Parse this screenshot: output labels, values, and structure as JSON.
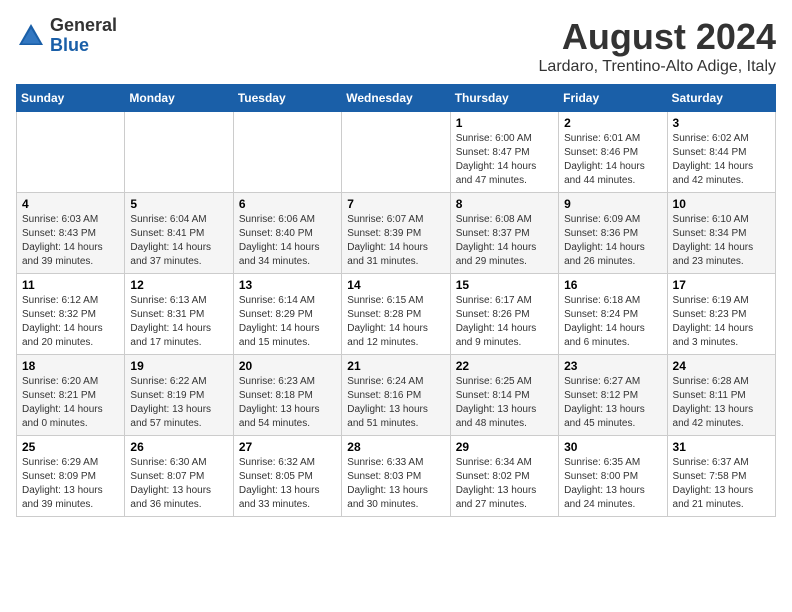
{
  "header": {
    "logo_general": "General",
    "logo_blue": "Blue",
    "month": "August 2024",
    "location": "Lardaro, Trentino-Alto Adige, Italy"
  },
  "weekdays": [
    "Sunday",
    "Monday",
    "Tuesday",
    "Wednesday",
    "Thursday",
    "Friday",
    "Saturday"
  ],
  "weeks": [
    [
      {
        "day": "",
        "content": ""
      },
      {
        "day": "",
        "content": ""
      },
      {
        "day": "",
        "content": ""
      },
      {
        "day": "",
        "content": ""
      },
      {
        "day": "1",
        "content": "Sunrise: 6:00 AM\nSunset: 8:47 PM\nDaylight: 14 hours\nand 47 minutes."
      },
      {
        "day": "2",
        "content": "Sunrise: 6:01 AM\nSunset: 8:46 PM\nDaylight: 14 hours\nand 44 minutes."
      },
      {
        "day": "3",
        "content": "Sunrise: 6:02 AM\nSunset: 8:44 PM\nDaylight: 14 hours\nand 42 minutes."
      }
    ],
    [
      {
        "day": "4",
        "content": "Sunrise: 6:03 AM\nSunset: 8:43 PM\nDaylight: 14 hours\nand 39 minutes."
      },
      {
        "day": "5",
        "content": "Sunrise: 6:04 AM\nSunset: 8:41 PM\nDaylight: 14 hours\nand 37 minutes."
      },
      {
        "day": "6",
        "content": "Sunrise: 6:06 AM\nSunset: 8:40 PM\nDaylight: 14 hours\nand 34 minutes."
      },
      {
        "day": "7",
        "content": "Sunrise: 6:07 AM\nSunset: 8:39 PM\nDaylight: 14 hours\nand 31 minutes."
      },
      {
        "day": "8",
        "content": "Sunrise: 6:08 AM\nSunset: 8:37 PM\nDaylight: 14 hours\nand 29 minutes."
      },
      {
        "day": "9",
        "content": "Sunrise: 6:09 AM\nSunset: 8:36 PM\nDaylight: 14 hours\nand 26 minutes."
      },
      {
        "day": "10",
        "content": "Sunrise: 6:10 AM\nSunset: 8:34 PM\nDaylight: 14 hours\nand 23 minutes."
      }
    ],
    [
      {
        "day": "11",
        "content": "Sunrise: 6:12 AM\nSunset: 8:32 PM\nDaylight: 14 hours\nand 20 minutes."
      },
      {
        "day": "12",
        "content": "Sunrise: 6:13 AM\nSunset: 8:31 PM\nDaylight: 14 hours\nand 17 minutes."
      },
      {
        "day": "13",
        "content": "Sunrise: 6:14 AM\nSunset: 8:29 PM\nDaylight: 14 hours\nand 15 minutes."
      },
      {
        "day": "14",
        "content": "Sunrise: 6:15 AM\nSunset: 8:28 PM\nDaylight: 14 hours\nand 12 minutes."
      },
      {
        "day": "15",
        "content": "Sunrise: 6:17 AM\nSunset: 8:26 PM\nDaylight: 14 hours\nand 9 minutes."
      },
      {
        "day": "16",
        "content": "Sunrise: 6:18 AM\nSunset: 8:24 PM\nDaylight: 14 hours\nand 6 minutes."
      },
      {
        "day": "17",
        "content": "Sunrise: 6:19 AM\nSunset: 8:23 PM\nDaylight: 14 hours\nand 3 minutes."
      }
    ],
    [
      {
        "day": "18",
        "content": "Sunrise: 6:20 AM\nSunset: 8:21 PM\nDaylight: 14 hours\nand 0 minutes."
      },
      {
        "day": "19",
        "content": "Sunrise: 6:22 AM\nSunset: 8:19 PM\nDaylight: 13 hours\nand 57 minutes."
      },
      {
        "day": "20",
        "content": "Sunrise: 6:23 AM\nSunset: 8:18 PM\nDaylight: 13 hours\nand 54 minutes."
      },
      {
        "day": "21",
        "content": "Sunrise: 6:24 AM\nSunset: 8:16 PM\nDaylight: 13 hours\nand 51 minutes."
      },
      {
        "day": "22",
        "content": "Sunrise: 6:25 AM\nSunset: 8:14 PM\nDaylight: 13 hours\nand 48 minutes."
      },
      {
        "day": "23",
        "content": "Sunrise: 6:27 AM\nSunset: 8:12 PM\nDaylight: 13 hours\nand 45 minutes."
      },
      {
        "day": "24",
        "content": "Sunrise: 6:28 AM\nSunset: 8:11 PM\nDaylight: 13 hours\nand 42 minutes."
      }
    ],
    [
      {
        "day": "25",
        "content": "Sunrise: 6:29 AM\nSunset: 8:09 PM\nDaylight: 13 hours\nand 39 minutes."
      },
      {
        "day": "26",
        "content": "Sunrise: 6:30 AM\nSunset: 8:07 PM\nDaylight: 13 hours\nand 36 minutes."
      },
      {
        "day": "27",
        "content": "Sunrise: 6:32 AM\nSunset: 8:05 PM\nDaylight: 13 hours\nand 33 minutes."
      },
      {
        "day": "28",
        "content": "Sunrise: 6:33 AM\nSunset: 8:03 PM\nDaylight: 13 hours\nand 30 minutes."
      },
      {
        "day": "29",
        "content": "Sunrise: 6:34 AM\nSunset: 8:02 PM\nDaylight: 13 hours\nand 27 minutes."
      },
      {
        "day": "30",
        "content": "Sunrise: 6:35 AM\nSunset: 8:00 PM\nDaylight: 13 hours\nand 24 minutes."
      },
      {
        "day": "31",
        "content": "Sunrise: 6:37 AM\nSunset: 7:58 PM\nDaylight: 13 hours\nand 21 minutes."
      }
    ]
  ]
}
